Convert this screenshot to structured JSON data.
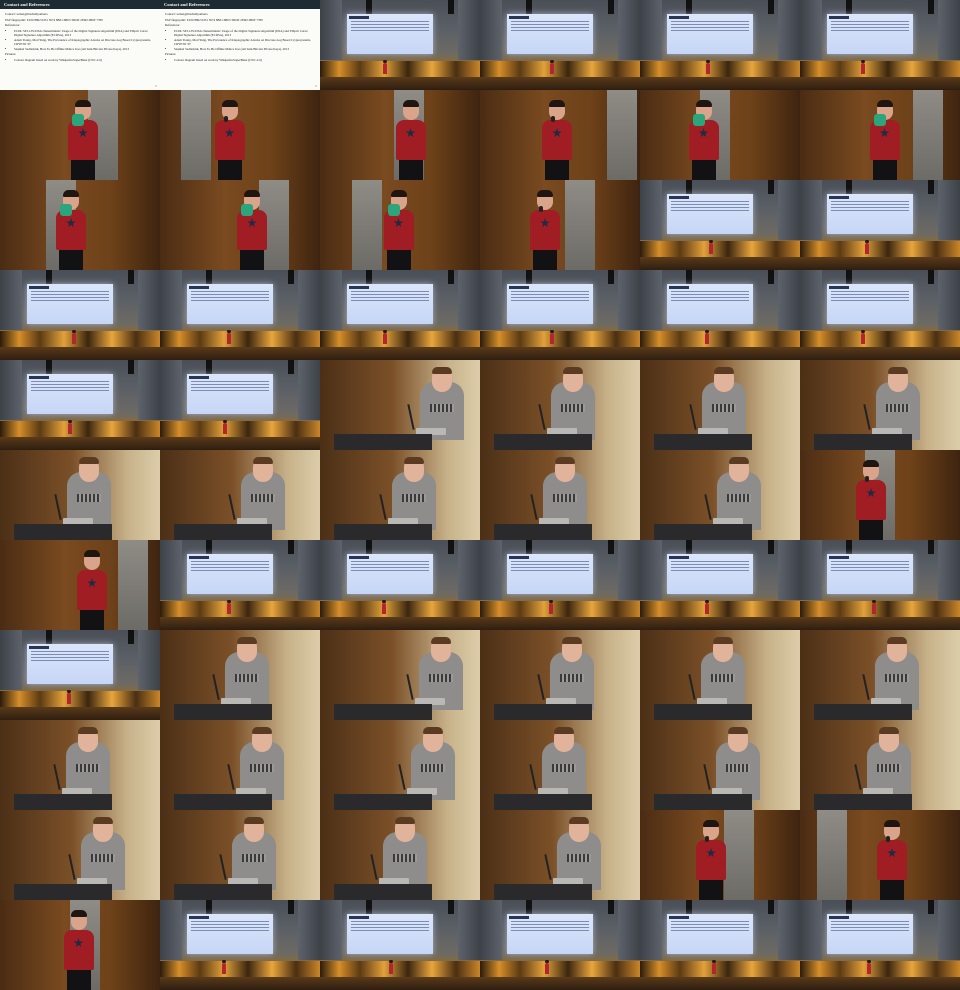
{
  "grid": {
    "columns": 6,
    "rows": 11
  },
  "slide_document": {
    "heading": "Contact and References",
    "contact_label": "Contact:",
    "contact_value": "tomas@hrschellpomona",
    "pgp_label": "PGP fingerprint:",
    "pgp_value": "E100 8802 0431 5074 8B21 6B03 3DOE 2E6D 2B0F 7780",
    "references_label": "References:",
    "references": [
      "ECDL SEC1/ECDSA: Deterministic Usage of the Digital Signature Algorithm (DSA) and Elliptic Curve Digital Signature Algorithm (ECDSA), 2013",
      "Adam Young, Moti Yung, The Prevalence of Kleptographic Attacks on Discrete-Log Based Cryptosystems, CRYPTO '97",
      "Stephen Sedlarkirk, How To Be Offline Malice Use (All Link Bitcoin Private Keys), 2013"
    ],
    "pictures_label": "Pictures:",
    "pictures": [
      "Convex diagram based on work by Wikipedia/SuperBana (CNC-2.0)"
    ],
    "page_number": "6"
  },
  "tiles": [
    "document",
    "document",
    "wide",
    "wide",
    "wide",
    "wide",
    "red-prop",
    "red-mic",
    "red",
    "red-mic",
    "red-prop",
    "red-prop",
    "red-prop",
    "red-prop",
    "red-prop",
    "red-mic",
    "wide",
    "wide",
    "wide",
    "wide",
    "wide",
    "wide",
    "wide",
    "wide",
    "wide",
    "wide",
    "lectern-side",
    "lectern",
    "lectern",
    "lectern",
    "lectern-gesture",
    "lectern",
    "lectern",
    "lectern",
    "lectern",
    "red-mic",
    "red",
    "wide",
    "wide",
    "wide",
    "wide",
    "wide",
    "wide",
    "lectern",
    "lectern-side",
    "lectern",
    "lectern",
    "lectern",
    "lectern",
    "lectern",
    "lectern-side",
    "lectern-gesture",
    "lectern",
    "lectern",
    "lectern",
    "lectern",
    "lectern",
    "lectern",
    "red-mic",
    "red-mic",
    "red",
    "wide",
    "wide",
    "wide",
    "wide",
    "wide"
  ]
}
